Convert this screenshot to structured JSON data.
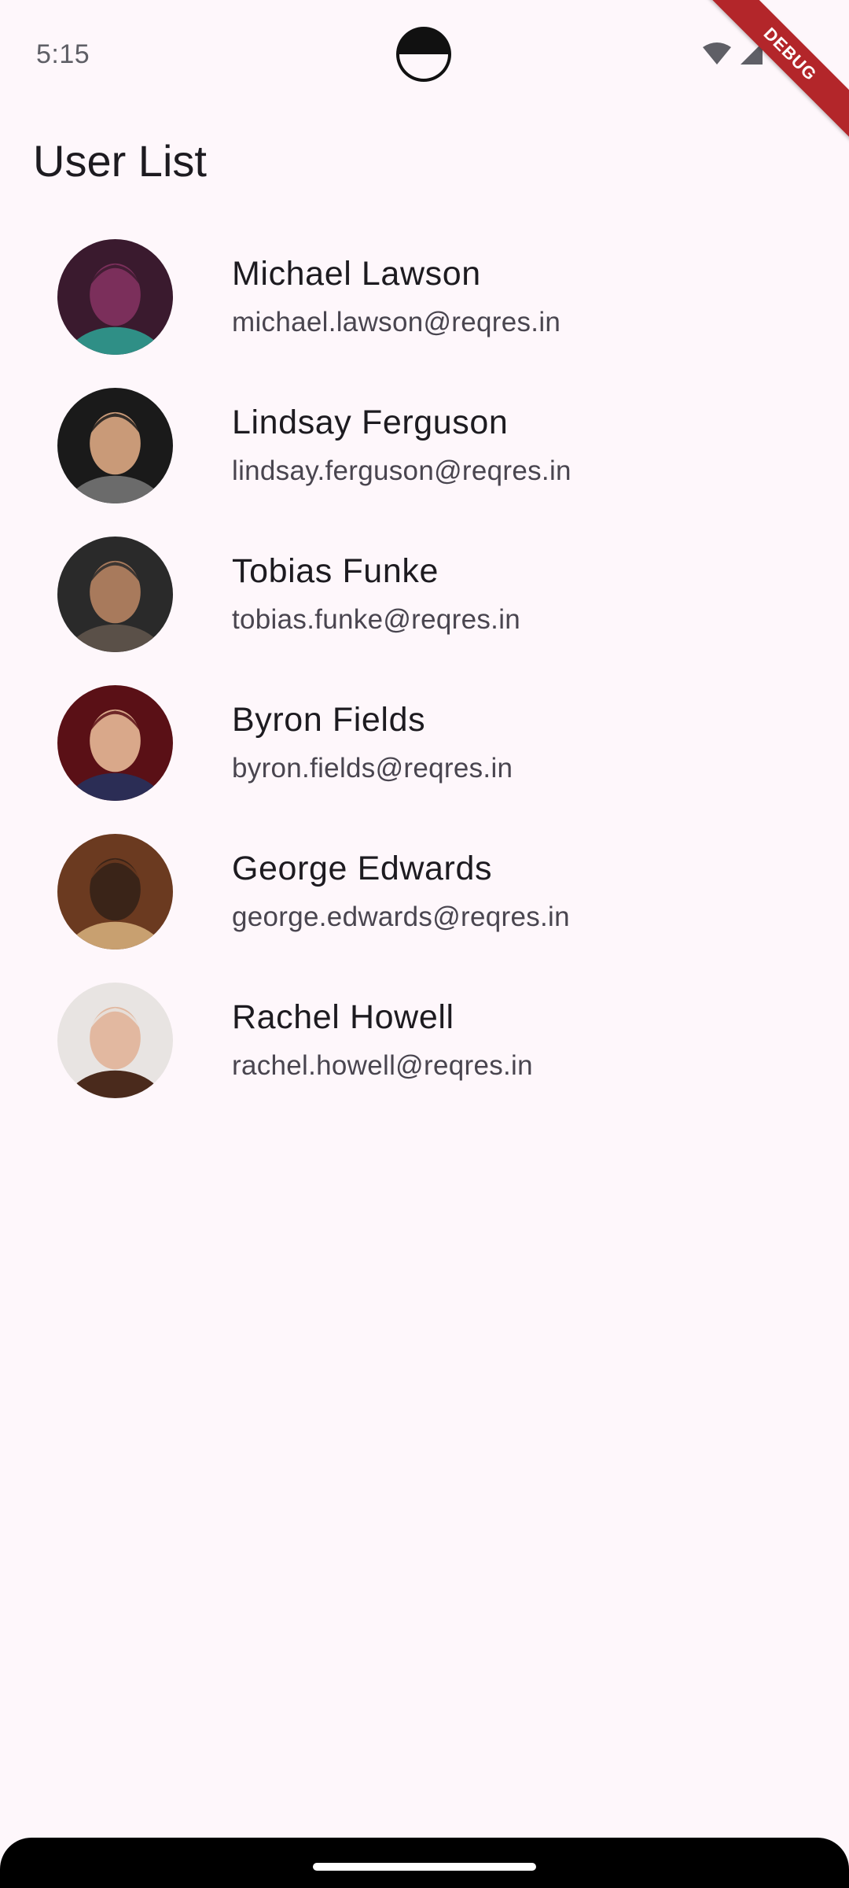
{
  "status_bar": {
    "time": "5:15",
    "icons": [
      "wifi-icon",
      "signal-icon"
    ]
  },
  "debug_banner": {
    "label": "DEBUG"
  },
  "app_bar": {
    "title": "User List"
  },
  "users": [
    {
      "name": "Michael Lawson",
      "email": "michael.lawson@reqres.in",
      "avatar_colors": [
        "#3a1a2e",
        "#7b2f5b",
        "#2f8f86"
      ]
    },
    {
      "name": "Lindsay Ferguson",
      "email": "lindsay.ferguson@reqres.in",
      "avatar_colors": [
        "#1a1a1a",
        "#c99a78",
        "#6b6b6b"
      ]
    },
    {
      "name": "Tobias Funke",
      "email": "tobias.funke@reqres.in",
      "avatar_colors": [
        "#2a2a2a",
        "#a87a5c",
        "#5a5048"
      ]
    },
    {
      "name": "Byron Fields",
      "email": "byron.fields@reqres.in",
      "avatar_colors": [
        "#5a1016",
        "#d9a88a",
        "#2b2d55"
      ]
    },
    {
      "name": "George Edwards",
      "email": "george.edwards@reqres.in",
      "avatar_colors": [
        "#6b3a20",
        "#3a2418",
        "#c8a070"
      ]
    },
    {
      "name": "Rachel Howell",
      "email": "rachel.howell@reqres.in",
      "avatar_colors": [
        "#e8e4e2",
        "#e2b8a0",
        "#4a2a1c"
      ]
    }
  ],
  "colors": {
    "background": "#fef7fb",
    "title": "#1d1b20",
    "subtitle": "#49454f",
    "debug": "#b3262a"
  }
}
